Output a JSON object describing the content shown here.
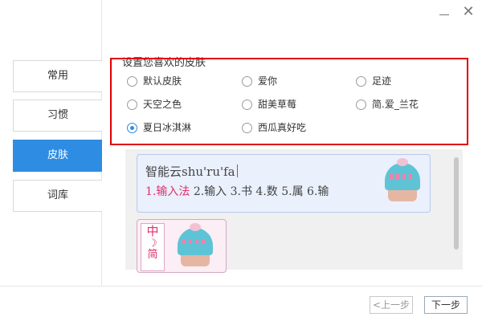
{
  "window": {
    "minimize_icon": "minimize-icon",
    "close_label": "✕"
  },
  "sidebar": {
    "items": [
      {
        "label": "常用"
      },
      {
        "label": "习惯"
      },
      {
        "label": "皮肤"
      },
      {
        "label": "词库"
      }
    ],
    "active_index": 2
  },
  "main": {
    "section_title": "设置您喜欢的皮肤",
    "skins": [
      {
        "label": "默认皮肤",
        "checked": false
      },
      {
        "label": "爱你",
        "checked": false
      },
      {
        "label": "足迹",
        "checked": false
      },
      {
        "label": "天空之色",
        "checked": false
      },
      {
        "label": "甜美草莓",
        "checked": false
      },
      {
        "label": "简.爱_兰花",
        "checked": false
      },
      {
        "label": "夏日冰淇淋",
        "checked": true
      },
      {
        "label": "西瓜真好吃",
        "checked": false
      }
    ],
    "preview": {
      "pinyin": "智能云shu'ru'fa",
      "candidates_first": "1.输入法",
      "candidates_rest": "2.输入 3.书 4.数 5.属 6.输",
      "mini_vertical": {
        "char": "中",
        "moon": "☽",
        "third": "简"
      }
    }
  },
  "footer": {
    "prev_label": "<上一步",
    "next_label": "下一步"
  },
  "colors": {
    "accent": "#2e8ce3",
    "highlight_red": "#e00000",
    "candidate_pink": "#e0306a"
  }
}
